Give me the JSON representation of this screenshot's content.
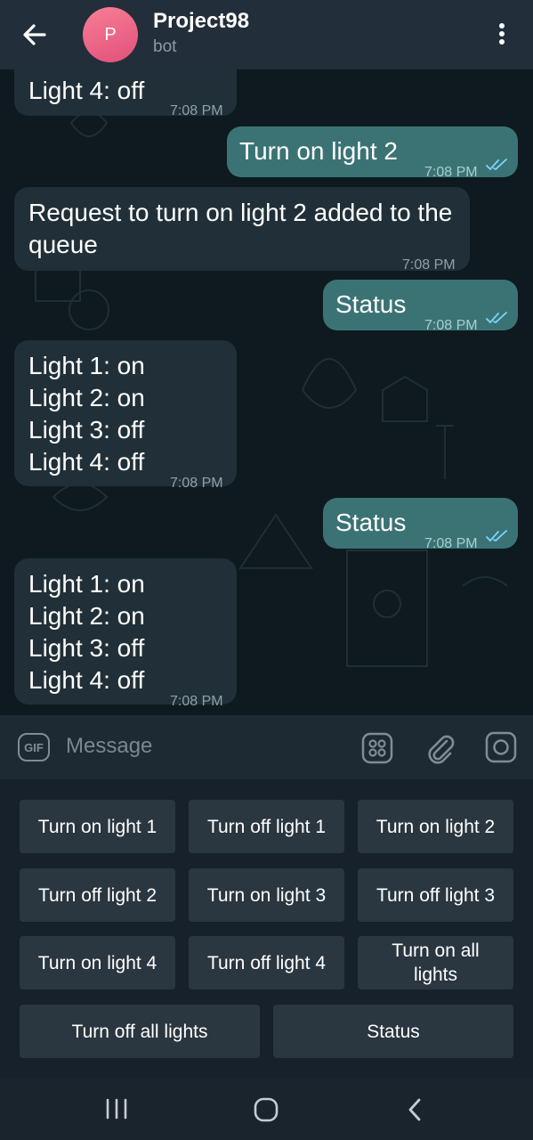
{
  "header": {
    "avatar_letter": "P",
    "title": "Project98",
    "subtitle": "bot"
  },
  "messages": [
    {
      "direction": "in",
      "text": "Light 4: off",
      "time": "7:08 PM"
    },
    {
      "direction": "out",
      "text": "Turn on light 2",
      "time": "7:08 PM",
      "read": true
    },
    {
      "direction": "in",
      "text": "Request to turn on light 2 added to the queue",
      "time": "7:08 PM"
    },
    {
      "direction": "out",
      "text": "Status",
      "time": "7:08 PM",
      "read": true
    },
    {
      "direction": "in",
      "text": "Light 1: on\nLight 2: on\nLight 3: off\nLight 4: off",
      "time": "7:08 PM"
    },
    {
      "direction": "out",
      "text": "Status",
      "time": "7:08 PM",
      "read": true
    },
    {
      "direction": "in",
      "text": "Light 1: on\nLight 2: on\nLight 3: off\nLight 4: off",
      "time": "7:08 PM"
    }
  ],
  "composer": {
    "gif_label": "GIF",
    "placeholder": "Message"
  },
  "keyboard": {
    "buttons": [
      "Turn on light 1",
      "Turn off light 1",
      "Turn on light 2",
      "Turn off light 2",
      "Turn on light 3",
      "Turn off light 3",
      "Turn on light 4",
      "Turn off light 4",
      "Turn on all lights",
      "Turn off all lights",
      "Status"
    ]
  },
  "icons": {
    "back": "arrow-left-icon",
    "menu": "more-vertical-icon",
    "sticker": "sticker-grid-icon",
    "attach": "paperclip-icon",
    "camera": "camera-icon",
    "nav_recents": "recents-icon",
    "nav_home": "home-icon",
    "nav_back": "nav-back-icon"
  },
  "colors": {
    "header_bg": "#222e39",
    "incoming_bubble": "#213038",
    "outgoing_bubble": "#3b7375",
    "keyboard_button": "#2a3640",
    "read_ticks": "#7fd4ff"
  }
}
